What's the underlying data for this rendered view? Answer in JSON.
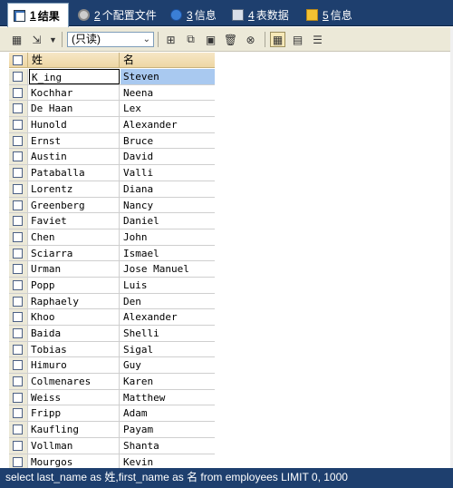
{
  "tabs": [
    {
      "num": "1",
      "label": "结果",
      "icon": "grid-icon"
    },
    {
      "num": "2",
      "label": "个配置文件",
      "icon": "gear-icon"
    },
    {
      "num": "3",
      "label": "信息",
      "icon": "info-icon"
    },
    {
      "num": "4",
      "label": "表数据",
      "icon": "table-icon"
    },
    {
      "num": "5",
      "label": "信息",
      "icon": "message-icon"
    }
  ],
  "toolbar": {
    "mode_value": "(只读)"
  },
  "grid": {
    "columns": [
      "姓",
      "名"
    ],
    "rows": [
      [
        "K_ing",
        "Steven"
      ],
      [
        "Kochhar",
        "Neena"
      ],
      [
        "De Haan",
        "Lex"
      ],
      [
        "Hunold",
        "Alexander"
      ],
      [
        "Ernst",
        "Bruce"
      ],
      [
        "Austin",
        "David"
      ],
      [
        "Pataballa",
        "Valli"
      ],
      [
        "Lorentz",
        "Diana"
      ],
      [
        "Greenberg",
        "Nancy"
      ],
      [
        "Faviet",
        "Daniel"
      ],
      [
        "Chen",
        "John"
      ],
      [
        "Sciarra",
        "Ismael"
      ],
      [
        "Urman",
        "Jose Manuel"
      ],
      [
        "Popp",
        "Luis"
      ],
      [
        "Raphaely",
        "Den"
      ],
      [
        "Khoo",
        "Alexander"
      ],
      [
        "Baida",
        "Shelli"
      ],
      [
        "Tobias",
        "Sigal"
      ],
      [
        "Himuro",
        "Guy"
      ],
      [
        "Colmenares",
        "Karen"
      ],
      [
        "Weiss",
        "Matthew"
      ],
      [
        "Fripp",
        "Adam"
      ],
      [
        "Kaufling",
        "Payam"
      ],
      [
        "Vollman",
        "Shanta"
      ],
      [
        "Mourgos",
        "Kevin"
      ]
    ]
  },
  "status": {
    "query": "select last_name as 姓,first_name as 名 from employees LIMIT 0, 1000"
  }
}
